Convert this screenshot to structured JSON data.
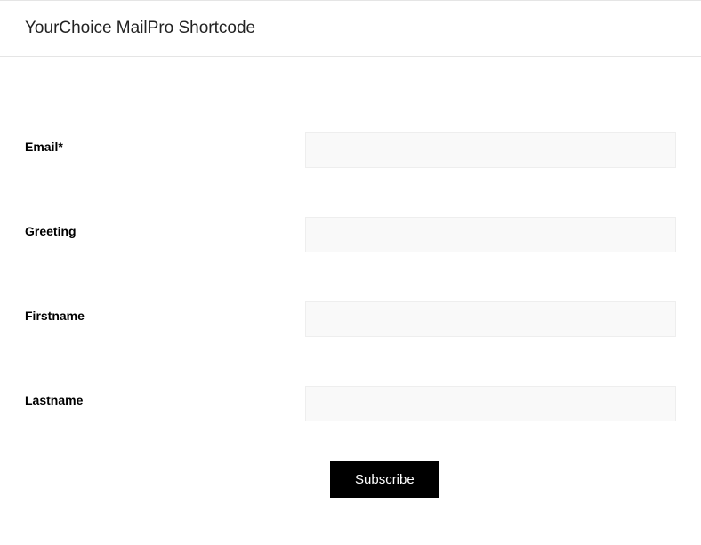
{
  "header": {
    "title": "YourChoice MailPro Shortcode"
  },
  "form": {
    "fields": {
      "email": {
        "label": "Email*",
        "value": ""
      },
      "greeting": {
        "label": "Greeting",
        "value": ""
      },
      "firstname": {
        "label": "Firstname",
        "value": ""
      },
      "lastname": {
        "label": "Lastname",
        "value": ""
      }
    },
    "submit_label": "Subscribe"
  }
}
